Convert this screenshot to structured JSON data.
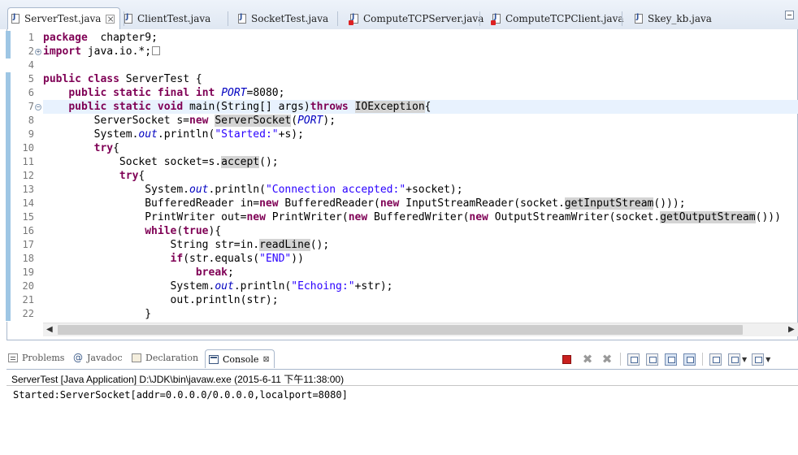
{
  "editor_tabs": [
    {
      "label": "ServerTest.java",
      "active": true,
      "error": false
    },
    {
      "label": "ClientTest.java",
      "active": false,
      "error": false
    },
    {
      "label": "SocketTest.java",
      "active": false,
      "error": false
    },
    {
      "label": "ComputeTCPServer.java",
      "active": false,
      "error": true
    },
    {
      "label": "ComputeTCPClient.java",
      "active": false,
      "error": true
    },
    {
      "label": "Skey_kb.java",
      "active": false,
      "error": false
    }
  ],
  "editor": {
    "line_numbers": [
      "1",
      "2",
      "4",
      "5",
      "6",
      "7",
      "8",
      "9",
      "10",
      "11",
      "12",
      "13",
      "14",
      "15",
      "16",
      "17",
      "18",
      "19",
      "20",
      "21",
      "22"
    ],
    "current_line_index": 5,
    "lines": [
      [
        [
          "kw",
          "package"
        ],
        [
          "",
          "  chapter9;"
        ]
      ],
      [
        [
          "kw",
          "import"
        ],
        [
          "",
          " java.io.*;"
        ],
        [
          "fold-box",
          ""
        ]
      ],
      [],
      [
        [
          "kw",
          "public"
        ],
        [
          "",
          " "
        ],
        [
          "kw",
          "class"
        ],
        [
          "",
          " ServerTest {"
        ]
      ],
      [
        [
          "",
          "    "
        ],
        [
          "kw",
          "public"
        ],
        [
          "",
          " "
        ],
        [
          "kw",
          "static"
        ],
        [
          "",
          " "
        ],
        [
          "kw",
          "final"
        ],
        [
          "",
          " "
        ],
        [
          "kw",
          "int"
        ],
        [
          "",
          " "
        ],
        [
          "fld",
          "PORT"
        ],
        [
          "",
          "=8080;"
        ]
      ],
      [
        [
          "",
          "    "
        ],
        [
          "kw",
          "public"
        ],
        [
          "",
          " "
        ],
        [
          "kw",
          "static"
        ],
        [
          "",
          " "
        ],
        [
          "kw",
          "void"
        ],
        [
          "",
          " main(String[] args)"
        ],
        [
          "kw",
          "throws"
        ],
        [
          "",
          " "
        ],
        [
          "occ",
          "IOException"
        ],
        [
          "",
          "{"
        ]
      ],
      [
        [
          "",
          "        ServerSocket s="
        ],
        [
          "kw",
          "new"
        ],
        [
          "",
          " "
        ],
        [
          "occ",
          "ServerSocket"
        ],
        [
          "",
          "("
        ],
        [
          "fld",
          "PORT"
        ],
        [
          "",
          ");"
        ]
      ],
      [
        [
          "",
          "        System."
        ],
        [
          "fld",
          "out"
        ],
        [
          "",
          ".println("
        ],
        [
          "str",
          "\"Started:\""
        ],
        [
          "",
          "+s);"
        ]
      ],
      [
        [
          "",
          "        "
        ],
        [
          "kw",
          "try"
        ],
        [
          "",
          "{"
        ]
      ],
      [
        [
          "",
          "            Socket socket=s."
        ],
        [
          "occ",
          "accept"
        ],
        [
          "",
          "();"
        ]
      ],
      [
        [
          "",
          "            "
        ],
        [
          "kw",
          "try"
        ],
        [
          "",
          "{"
        ]
      ],
      [
        [
          "",
          "                System."
        ],
        [
          "fld",
          "out"
        ],
        [
          "",
          ".println("
        ],
        [
          "str",
          "\"Connection accepted:\""
        ],
        [
          "",
          "+socket);"
        ]
      ],
      [
        [
          "",
          "                BufferedReader in="
        ],
        [
          "kw",
          "new"
        ],
        [
          "",
          " BufferedReader("
        ],
        [
          "kw",
          "new"
        ],
        [
          "",
          " InputStreamReader(socket."
        ],
        [
          "occ",
          "getInputStream"
        ],
        [
          "",
          "()));"
        ]
      ],
      [
        [
          "",
          "                PrintWriter out="
        ],
        [
          "kw",
          "new"
        ],
        [
          "",
          " PrintWriter("
        ],
        [
          "kw",
          "new"
        ],
        [
          "",
          " BufferedWriter("
        ],
        [
          "kw",
          "new"
        ],
        [
          "",
          " OutputStreamWriter(socket."
        ],
        [
          "occ",
          "getOutputStream"
        ],
        [
          "",
          "()))"
        ]
      ],
      [
        [
          "",
          "                "
        ],
        [
          "kw",
          "while"
        ],
        [
          "",
          "("
        ],
        [
          "kw",
          "true"
        ],
        [
          "",
          "){"
        ]
      ],
      [
        [
          "",
          "                    String str=in."
        ],
        [
          "occ",
          "readLine"
        ],
        [
          "",
          "();"
        ]
      ],
      [
        [
          "",
          "                    "
        ],
        [
          "kw",
          "if"
        ],
        [
          "",
          "(str.equals("
        ],
        [
          "str",
          "\"END\""
        ],
        [
          "",
          "))"
        ]
      ],
      [
        [
          "",
          "                        "
        ],
        [
          "kw",
          "break"
        ],
        [
          "",
          ";"
        ]
      ],
      [
        [
          "",
          "                    System."
        ],
        [
          "fld",
          "out"
        ],
        [
          "",
          ".println("
        ],
        [
          "str",
          "\"Echoing:\""
        ],
        [
          "",
          "+str);"
        ]
      ],
      [
        [
          "",
          "                    out.println(str);"
        ]
      ],
      [
        [
          "",
          "                }"
        ]
      ]
    ]
  },
  "view_tabs": [
    {
      "label": "Problems",
      "icon": "problems-icon",
      "active": false
    },
    {
      "label": "Javadoc",
      "icon": "javadoc-icon",
      "active": false
    },
    {
      "label": "Declaration",
      "icon": "declaration-icon",
      "active": false
    },
    {
      "label": "Console",
      "icon": "console-icon",
      "active": true
    }
  ],
  "console": {
    "title": "ServerTest [Java Application] D:\\JDK\\bin\\javaw.exe (2015-6-11 下午11:38:00)",
    "output": "Started:ServerSocket[addr=0.0.0.0/0.0.0.0,localport=8080]"
  },
  "colors": {
    "keyword": "#7f0055",
    "string": "#2a00ff",
    "static_field": "#0000c0",
    "current_line": "#e8f2fe",
    "occurrence": "#d4d4d4",
    "terminate": "#c9201f"
  }
}
